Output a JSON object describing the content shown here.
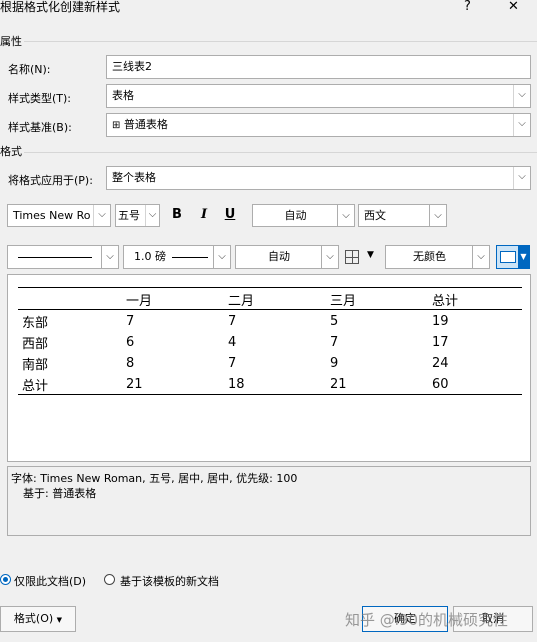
{
  "window": {
    "title": "根据格式化创建新样式",
    "help_label": "?",
    "close_label": "✕"
  },
  "properties": {
    "section_title": "属性",
    "name_label": "名称(N):",
    "name_value": "三线表2",
    "type_label": "样式类型(T):",
    "type_value": "表格",
    "based_label": "样式基准(B):",
    "based_value": "普通表格",
    "based_icon": "⊞"
  },
  "format": {
    "section_title": "格式",
    "apply_label": "将格式应用于(P):",
    "apply_value": "整个表格",
    "font_name": "Times New Ro",
    "font_size": "五号",
    "bold_label": "B",
    "italic_label": "I",
    "underline_label": "U",
    "font_color": "自动",
    "script": "西文",
    "line_width": "1.0 磅",
    "border_color": "自动",
    "shading": "无颜色"
  },
  "preview_table": {
    "headers": [
      "",
      "一月",
      "二月",
      "三月",
      "总计"
    ],
    "rows": [
      [
        "东部",
        "7",
        "7",
        "5",
        "19"
      ],
      [
        "西部",
        "6",
        "4",
        "7",
        "17"
      ],
      [
        "南部",
        "8",
        "7",
        "9",
        "24"
      ],
      [
        "总计",
        "21",
        "18",
        "21",
        "60"
      ]
    ]
  },
  "description": {
    "line1": "字体: Times New Roman, 五号, 居中, 居中, 优先级: 100",
    "line2": "基于: 普通表格"
  },
  "options": {
    "only_doc_label": "仅限此文档(D)",
    "template_label": "基于该模板的新文档"
  },
  "buttons": {
    "format_label": "格式(O)",
    "ok_label": "确定",
    "cancel_label": "取消"
  },
  "watermark": "知乎 @i90的机械硕究性",
  "colors": {
    "accent": "#0067c0",
    "background": "#f0f0f0"
  }
}
